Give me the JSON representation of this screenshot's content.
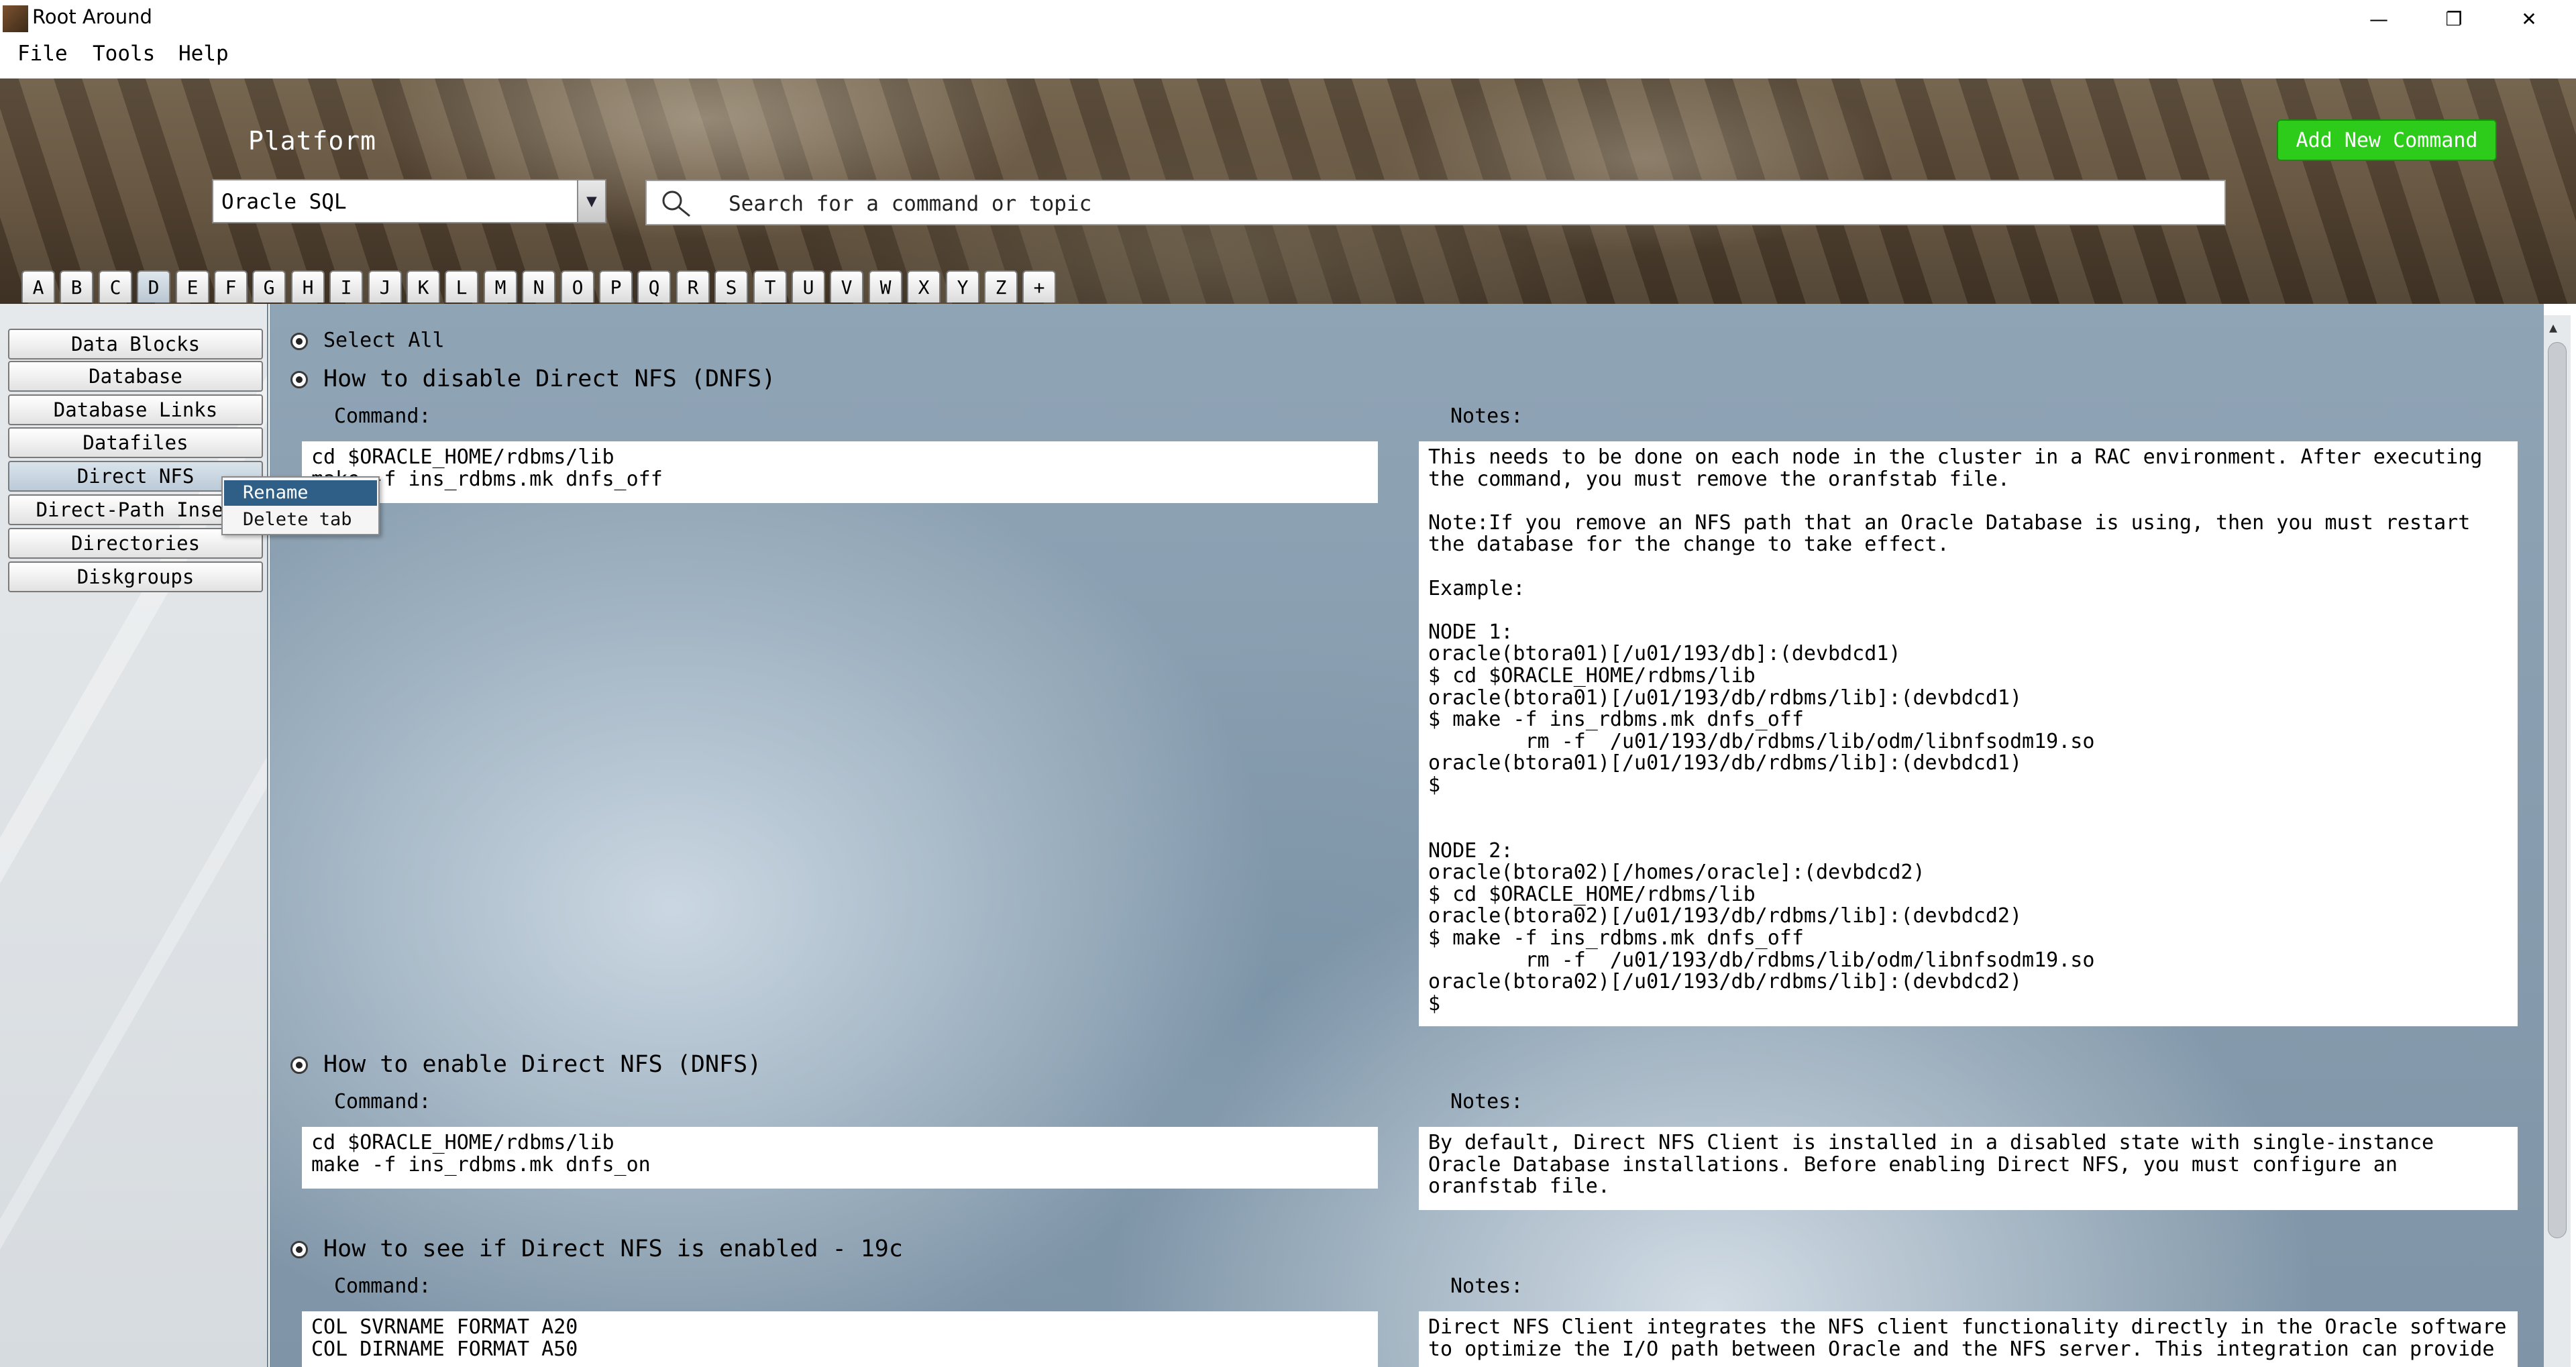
{
  "app": {
    "title": "Root Around"
  },
  "window": {
    "minimize": "—",
    "restore": "❐",
    "close": "✕"
  },
  "menu": [
    "File",
    "Tools",
    "Help"
  ],
  "header": {
    "platform_label": "Platform",
    "platform_selected": "Oracle SQL",
    "search_placeholder": "Search for a command or topic",
    "add_button": "Add New Command"
  },
  "alphabet": [
    "A",
    "B",
    "C",
    "D",
    "E",
    "F",
    "G",
    "H",
    "I",
    "J",
    "K",
    "L",
    "M",
    "N",
    "O",
    "P",
    "Q",
    "R",
    "S",
    "T",
    "U",
    "V",
    "W",
    "X",
    "Y",
    "Z",
    "+"
  ],
  "alphabet_active": "D",
  "sidebar": {
    "items": [
      "Data Blocks",
      "Database",
      "Database Links",
      "Datafiles",
      "Direct NFS",
      "Direct-Path Inser",
      "Directories",
      "Diskgroups"
    ],
    "active": "Direct NFS"
  },
  "context_menu": {
    "items": [
      "Rename",
      "Delete tab"
    ],
    "highlighted": "Rename"
  },
  "content": {
    "select_all": "Select All",
    "command_label": "Command:",
    "notes_label": "Notes:",
    "entries": [
      {
        "title": "How to disable Direct NFS (DNFS)",
        "command": "cd $ORACLE_HOME/rdbms/lib\nmake -f ins_rdbms.mk dnfs_off",
        "notes": "This needs to be done on each node in the cluster in a RAC environment. After executing\nthe command, you must remove the oranfstab file.\n\nNote:If you remove an NFS path that an Oracle Database is using, then you must restart\nthe database for the change to take effect.\n\nExample:\n\nNODE 1:\noracle(btora01)[/u01/193/db]:(devbdcd1)\n$ cd $ORACLE_HOME/rdbms/lib\noracle(btora01)[/u01/193/db/rdbms/lib]:(devbdcd1)\n$ make -f ins_rdbms.mk dnfs_off\n        rm -f  /u01/193/db/rdbms/lib/odm/libnfsodm19.so\noracle(btora01)[/u01/193/db/rdbms/lib]:(devbdcd1)\n$\n\n\nNODE 2:\noracle(btora02)[/homes/oracle]:(devbdcd2)\n$ cd $ORACLE_HOME/rdbms/lib\noracle(btora02)[/u01/193/db/rdbms/lib]:(devbdcd2)\n$ make -f ins_rdbms.mk dnfs_off\n        rm -f  /u01/193/db/rdbms/lib/odm/libnfsodm19.so\noracle(btora02)[/u01/193/db/rdbms/lib]:(devbdcd2)\n$"
      },
      {
        "title": "How to enable Direct NFS (DNFS)",
        "command": "cd $ORACLE_HOME/rdbms/lib\nmake -f ins_rdbms.mk dnfs_on",
        "notes": "By default, Direct NFS Client is installed in a disabled state with single-instance\nOracle Database installations. Before enabling Direct NFS, you must configure an\noranfstab file."
      },
      {
        "title": "How to see if Direct NFS is enabled - 19c",
        "command": "COL SVRNAME FORMAT A20\nCOL DIRNAME FORMAT A50",
        "notes": "Direct NFS Client integrates the NFS client functionality directly in the Oracle software\nto optimize the I/O path between Oracle and the NFS server. This integration can provide"
      }
    ]
  }
}
